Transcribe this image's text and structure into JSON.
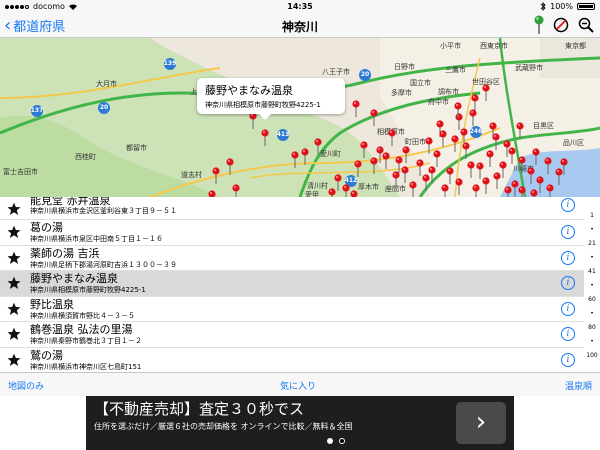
{
  "status_bar": {
    "carrier": "docomo",
    "time": "14:35",
    "battery": "100%"
  },
  "nav": {
    "back_label": "都道府県",
    "title": "神奈川"
  },
  "map": {
    "callout": {
      "name": "藤野やまなみ温泉",
      "address": "神奈川県相模原市藤野町牧野4225-1"
    },
    "labels": [
      "大月市",
      "上野原市",
      "八王子市",
      "日野市",
      "三鷹市",
      "国立市",
      "多摩市",
      "調布市",
      "世田谷区",
      "府中市",
      "町田市",
      "相模原市",
      "厚木市",
      "都留市",
      "道志村",
      "西桂町",
      "清川村",
      "座間市",
      "愛川町",
      "川崎市",
      "品川区",
      "目黒区",
      "小平市",
      "西東京市",
      "東京都",
      "武蔵野市",
      "富士吉田市",
      "愛甲"
    ],
    "road_numbers": [
      "139",
      "20",
      "137",
      "413",
      "246",
      "412",
      "20"
    ]
  },
  "spas": [
    {
      "name": "能見堂 赤井温泉",
      "address": "神奈川県横浜市金沢区釜利谷東３丁目９－５１"
    },
    {
      "name": "葛の湯",
      "address": "神奈川県横浜市泉区中田南５丁目１－１６"
    },
    {
      "name": "薬師の湯 吉浜",
      "address": "神奈川県足柄下郡湯河原町吉浜１３００－３９"
    },
    {
      "name": "藤野やまなみ温泉",
      "address": "神奈川県相模原市藤野町牧野4225-1"
    },
    {
      "name": "野比温泉",
      "address": "神奈川県横須賀市野比４－３－５"
    },
    {
      "name": "鶴巻温泉 弘法の里湯",
      "address": "神奈川県秦野市鶴巻北３丁目１－２"
    },
    {
      "name": "鷲の湯",
      "address": "神奈川県横浜市神奈川区七島町151"
    }
  ],
  "selected_index": 3,
  "index_strip": [
    "1",
    "•",
    "21",
    "•",
    "41",
    "•",
    "60",
    "•",
    "80",
    "•",
    "100"
  ],
  "toolbar": {
    "left": "地図のみ",
    "center": "気に入り",
    "right": "温泉順"
  },
  "ad": {
    "headline": "【不動産売却】査定３０秒でス",
    "sub": "住所を選ぶだけ／厳選６社の売却価格を オンラインで比較／無料＆全国",
    "arrow": "›"
  },
  "colors": {
    "accent": "#1677f5",
    "pin": "#e0121a",
    "road": "#42b549",
    "selected_row": "#d9d9d9"
  }
}
